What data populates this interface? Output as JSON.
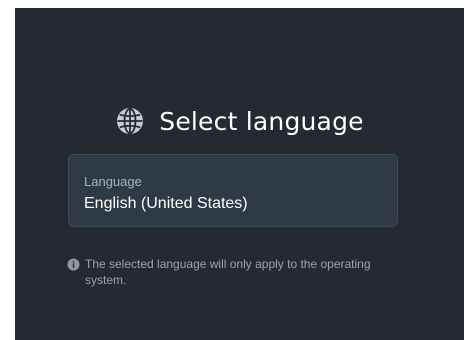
{
  "dialog": {
    "title": "Select language",
    "title_icon": "globe-icon"
  },
  "language_field": {
    "label": "Language",
    "value": "English (United States)"
  },
  "note": {
    "icon": "info-icon",
    "text": "The selected language will only apply to the operating system."
  },
  "colors": {
    "background": "#252932",
    "field_background": "#2f3a47",
    "title_text": "#ffffff",
    "secondary_text": "#9aa3ad"
  }
}
